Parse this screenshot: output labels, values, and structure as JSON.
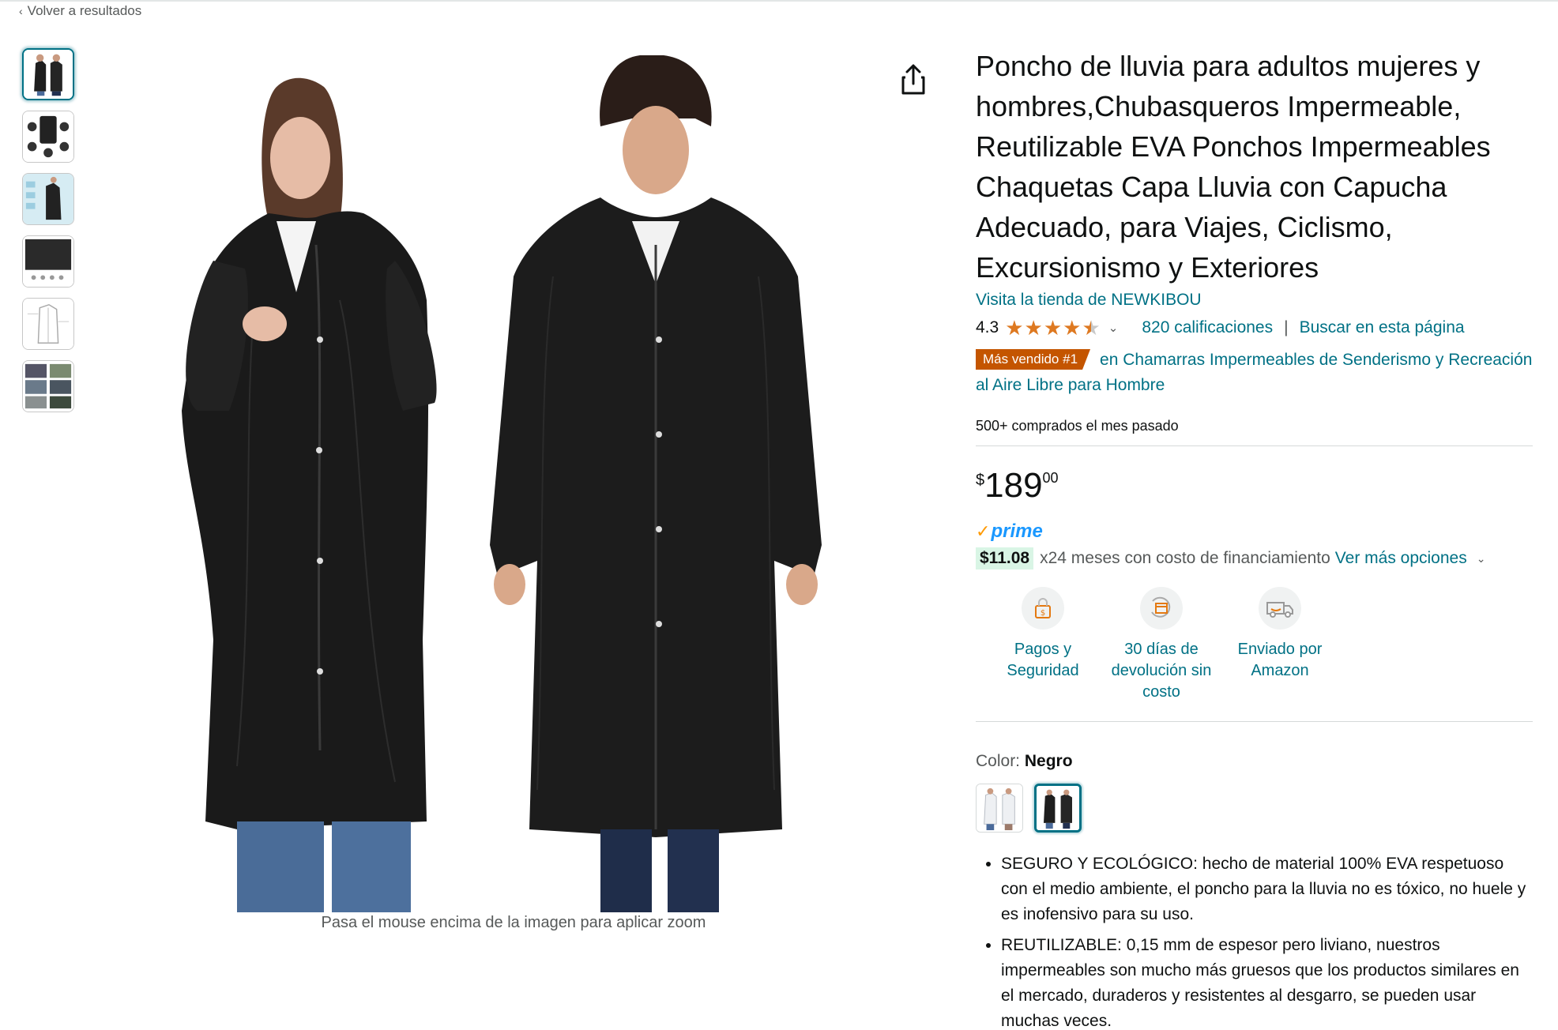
{
  "nav": {
    "back_label": "Volver a resultados"
  },
  "gallery": {
    "thumbnail_count": 6,
    "zoom_hint": "Pasa el mouse encima de la imagen para aplicar zoom"
  },
  "product": {
    "title": "Poncho de lluvia para adultos mujeres y hombres,Chubasqueros Impermeable, Reutilizable EVA Ponchos Impermeables Chaquetas Capa Lluvia con Capucha Adecuado, para Viajes, Ciclismo, Excursionismo y Exteriores",
    "store_link": "Visita la tienda de NEWKIBOU",
    "rating_value": "4.3",
    "rating_stars": 4.3,
    "ratings_count": "820 calificaciones",
    "search_page": "Buscar en esta página",
    "separator": "|",
    "best_seller_badge": "Más vendido #1",
    "best_seller_category": "en Chamarras Impermeables de Senderismo y Recreación al Aire Libre para Hombre",
    "bought_last_month": "500+ comprados el mes pasado"
  },
  "price": {
    "symbol": "$",
    "whole": "189",
    "fraction": "00"
  },
  "prime": {
    "label": "prime"
  },
  "installments": {
    "amount": "$11.08",
    "text": "x24 meses con costo de financiamiento",
    "more_options": "Ver más opciones"
  },
  "badges": [
    {
      "icon": "secure-payment-icon",
      "label": "Pagos y Seguridad"
    },
    {
      "icon": "return-box-icon",
      "label": "30 días de devolución sin costo"
    },
    {
      "icon": "delivery-truck-icon",
      "label": "Enviado por Amazon"
    }
  ],
  "color": {
    "label": "Color:",
    "selected": "Negro"
  },
  "bullets": [
    "SEGURO Y ECOLÓGICO: hecho de material 100% EVA respetuoso con el medio ambiente, el poncho para la lluvia no es tóxico, no huele y es inofensivo para su uso.",
    "REUTILIZABLE: 0,15 mm de espesor pero liviano, nuestros impermeables son mucho más gruesos que los productos similares en el mercado, duraderos y resistentes al desgarro, se pueden usar muchas veces."
  ],
  "colors": {
    "link": "#007185",
    "star": "#de7921",
    "badge": "#c45500",
    "prime": "#1a98ff",
    "installment_bg": "#d9f5e5"
  }
}
